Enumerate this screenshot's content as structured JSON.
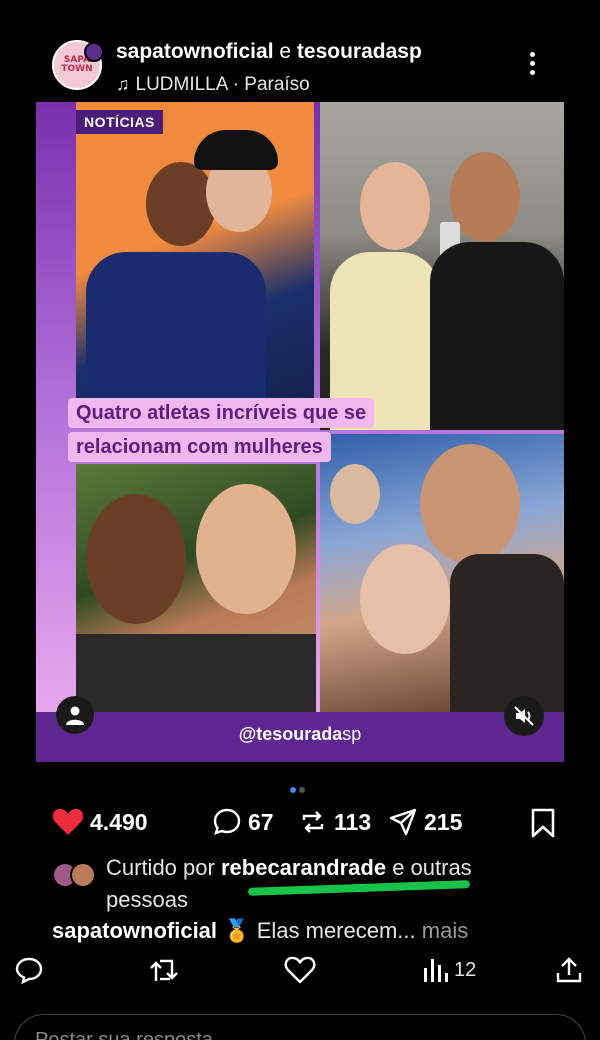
{
  "post": {
    "account_main": "sapatownoficial",
    "account_join": "e",
    "account_collab": "tesouradasp",
    "music_artist": "LUDMILLA",
    "music_separator": "·",
    "music_track": "Paraíso",
    "avatar_logo_line1": "SAPA",
    "avatar_logo_line2": "TOWN"
  },
  "media": {
    "tag": "NOTÍCIAS",
    "headline_line1": "Quatro atletas incríveis que se",
    "headline_line2": "relacionam com mulheres",
    "handle_prefix": "@tesourada",
    "handle_suffix": "sp",
    "slides_total": 2,
    "slide_active": 1
  },
  "actions": {
    "likes": "4.490",
    "comments": "67",
    "reposts": "113",
    "shares": "215"
  },
  "liked_by": {
    "prefix": "Curtido por",
    "user": "rebecarandrade",
    "suffix": "e outras pessoas"
  },
  "caption": {
    "user": "sapatownoficial",
    "medal_icon": "medal-icon",
    "text": "Elas merecem...",
    "more": "mais"
  },
  "tweet_bar": {
    "views": "12"
  },
  "reply": {
    "placeholder": "Postar sua resposta"
  },
  "colors": {
    "like_red": "#ed2c3c",
    "highlight_green": "#15c24a",
    "media_purple": "#5e2690",
    "headline_pink": "#f1b8ef"
  }
}
